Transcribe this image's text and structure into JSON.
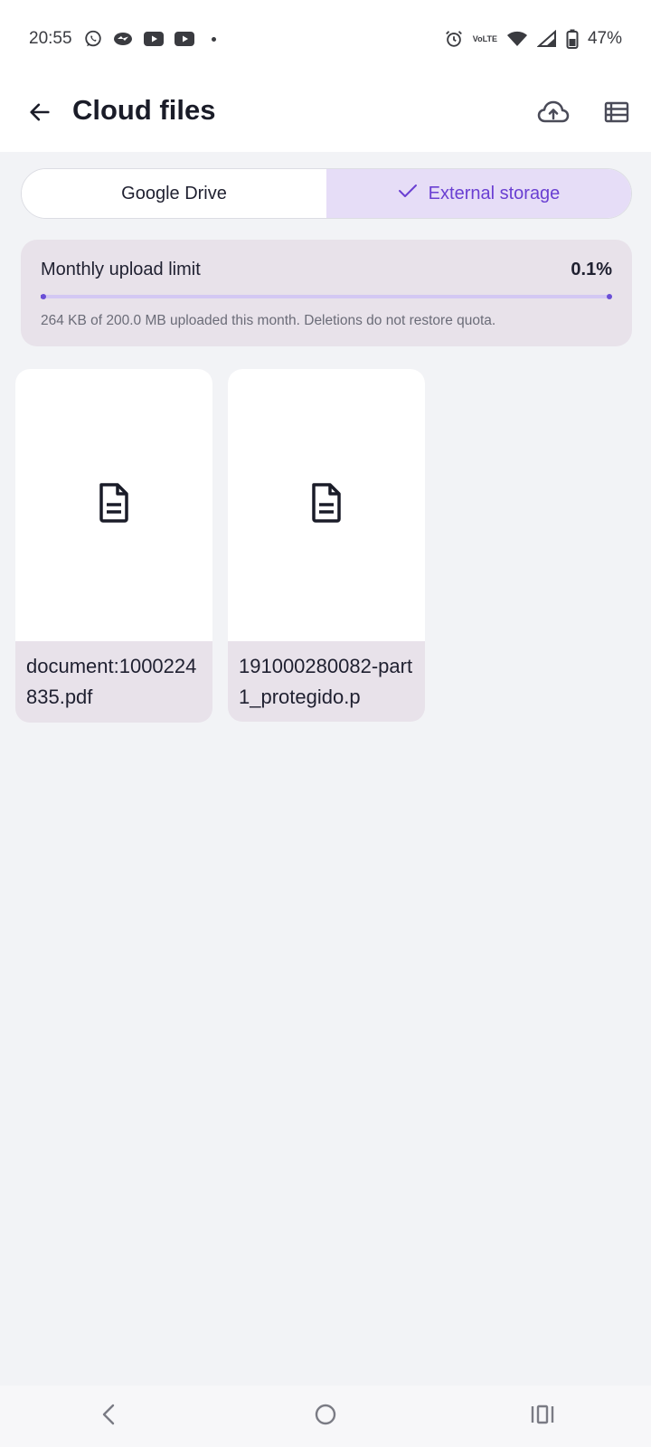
{
  "status_bar": {
    "time": "20:55",
    "left_icons": [
      "whatsapp-icon",
      "messenger-icon",
      "youtube-icon",
      "youtube-icon"
    ],
    "right_icons": [
      "alarm-icon",
      "volte-icon",
      "wifi-icon",
      "signal-icon",
      "battery-icon"
    ],
    "volte_top": "Vo",
    "volte_bottom": "LTE",
    "battery": "47%"
  },
  "app_bar": {
    "title": "Cloud files",
    "back_icon": "arrow-left-icon",
    "upload_icon": "cloud-upload-icon",
    "view_icon": "list-view-icon"
  },
  "tabs": {
    "google": "Google Drive",
    "external": "External storage",
    "selected": "external",
    "check_icon": "check-icon"
  },
  "quota": {
    "label": "Monthly upload limit",
    "percent": "0.1%",
    "progress_fraction": 0.001,
    "note": "264 KB of 200.0 MB uploaded this month. Deletions do not restore quota."
  },
  "files": [
    {
      "name": "document:1000224835.pdf",
      "icon": "document-icon"
    },
    {
      "name": "191000280082-part1_protegido.p",
      "icon": "document-icon"
    }
  ],
  "nav": {
    "back": "nav-back-icon",
    "home": "nav-home-icon",
    "recents": "nav-recents-icon"
  },
  "colors": {
    "accent": "#6a4fd6",
    "accent_text": "#6a3fd2",
    "selected_tab_bg": "#e6ddf7",
    "card_bg": "#e8e2ea",
    "page_bg": "#f2f3f6",
    "text_dark": "#1a1c28"
  }
}
